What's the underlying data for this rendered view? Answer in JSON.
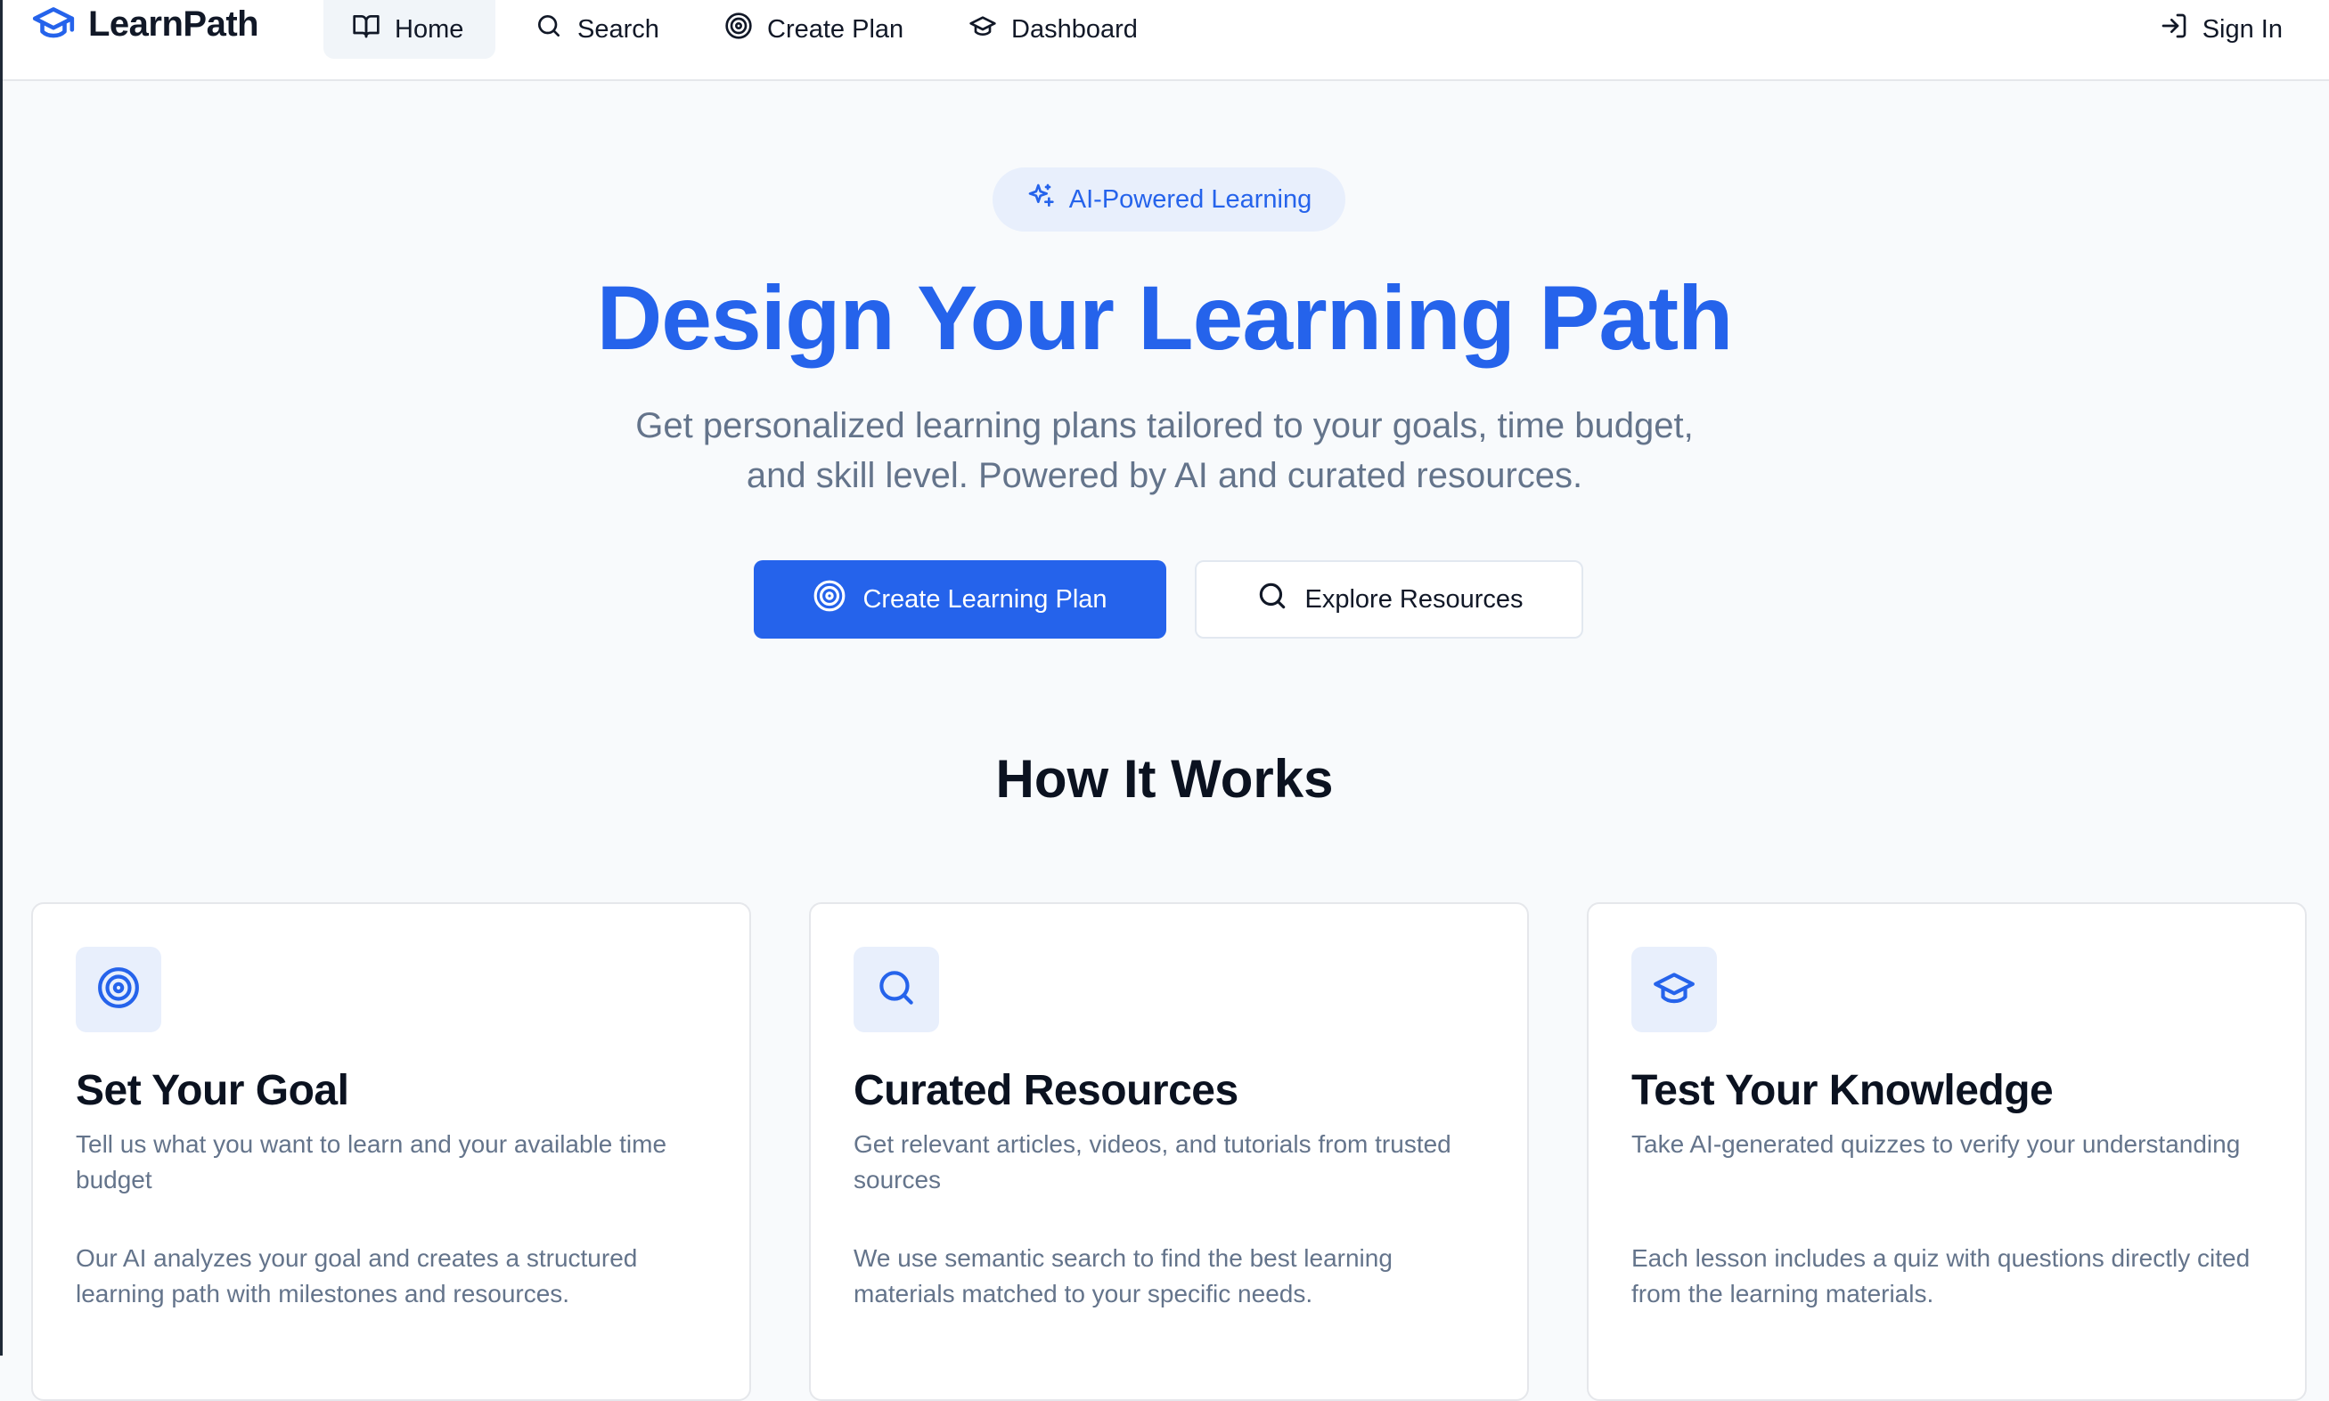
{
  "app": {
    "name": "LearnPath"
  },
  "colors": {
    "accent": "#2563eb",
    "accent_soft": "#e8effc",
    "muted_text": "#64748b",
    "heading": "#0b1220"
  },
  "nav": {
    "items": [
      {
        "label": "Home",
        "icon": "book-open-icon",
        "active": true
      },
      {
        "label": "Search",
        "icon": "search-icon",
        "active": false
      },
      {
        "label": "Create Plan",
        "icon": "target-icon",
        "active": false
      },
      {
        "label": "Dashboard",
        "icon": "graduation-cap-icon",
        "active": false
      }
    ],
    "sign_in": {
      "label": "Sign In",
      "icon": "log-in-icon"
    }
  },
  "hero": {
    "badge": {
      "label": "AI-Powered Learning",
      "icon": "sparkles-icon"
    },
    "title": "Design Your Learning Path",
    "subtitle_line1": "Get personalized learning plans tailored to your goals, time budget,",
    "subtitle_line2": "and skill level. Powered by AI and curated resources.",
    "primary_button": {
      "label": "Create Learning Plan",
      "icon": "target-icon"
    },
    "secondary_button": {
      "label": "Explore Resources",
      "icon": "search-icon"
    }
  },
  "how_it_works": {
    "title": "How It Works",
    "cards": [
      {
        "icon": "target-icon",
        "title": "Set Your Goal",
        "description": "Tell us what you want to learn and your available time budget",
        "body": "Our AI analyzes your goal and creates a structured learning path with milestones and resources."
      },
      {
        "icon": "search-icon",
        "title": "Curated Resources",
        "description": "Get relevant articles, videos, and tutorials from trusted sources",
        "body": "We use semantic search to find the best learning materials matched to your specific needs."
      },
      {
        "icon": "graduation-cap-icon",
        "title": "Test Your Knowledge",
        "description": "Take AI-generated quizzes to verify your understanding",
        "body": "Each lesson includes a quiz with questions directly cited from the learning materials."
      }
    ]
  }
}
